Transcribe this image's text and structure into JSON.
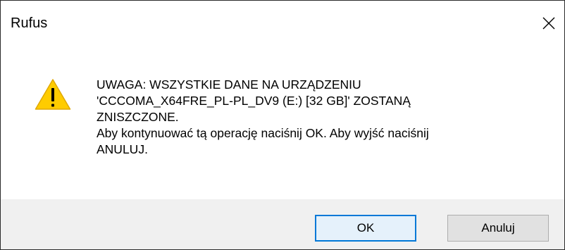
{
  "window": {
    "title": "Rufus"
  },
  "icons": {
    "close": "close-icon",
    "warning": "warning-icon"
  },
  "message": {
    "lines": [
      "UWAGA: WSZYSTKIE DANE NA URZĄDZENIU",
      "'CCCOMA_X64FRE_PL-PL_DV9 (E:) [32 GB]' ZOSTANĄ",
      "ZNISZCZONE.",
      "Aby kontynuować tą operację naciśnij OK. Aby wyjść naciśnij",
      "ANULUJ."
    ]
  },
  "buttons": {
    "ok_label": "OK",
    "cancel_label": "Anuluj"
  },
  "colors": {
    "warning_fill": "#FFCC00",
    "ok_border": "#0078D7",
    "footer_bg": "#F0F0F0"
  }
}
